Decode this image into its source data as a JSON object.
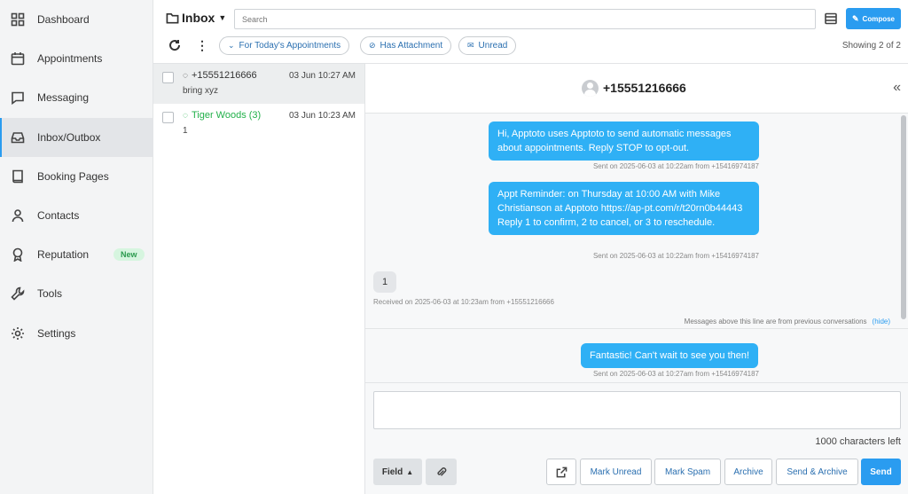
{
  "sidebar": {
    "items": [
      {
        "label": "Dashboard",
        "icon": "grid-icon"
      },
      {
        "label": "Appointments",
        "icon": "calendar-icon"
      },
      {
        "label": "Messaging",
        "icon": "chat-icon"
      },
      {
        "label": "Inbox/Outbox",
        "icon": "inbox-icon"
      },
      {
        "label": "Booking Pages",
        "icon": "book-icon"
      },
      {
        "label": "Contacts",
        "icon": "person-icon"
      },
      {
        "label": "Reputation",
        "icon": "award-icon",
        "badge": "New"
      },
      {
        "label": "Tools",
        "icon": "wrench-icon"
      },
      {
        "label": "Settings",
        "icon": "gear-icon"
      }
    ],
    "active": "Inbox/Outbox"
  },
  "header": {
    "folder": "Inbox",
    "search_placeholder": "Search",
    "compose_label": "Compose",
    "filters": [
      "For Today's Appointments",
      "Has Attachment",
      "Unread"
    ],
    "showing": "Showing 2 of 2"
  },
  "conversations": [
    {
      "name": "+15551216666",
      "date": "03 Jun 10:27 AM",
      "snippet": "bring xyz"
    },
    {
      "name": "Tiger Woods (3)",
      "date": "03 Jun 10:23 AM",
      "snippet": "1"
    }
  ],
  "thread": {
    "title": "+15551216666",
    "messages": [
      {
        "text": "Hi, Apptoto uses Apptoto to send automatic messages about appointments. Reply STOP to opt-out.",
        "meta": "Sent on 2025-06-03 at 10:22am from +15416974187"
      },
      {
        "text": "Appt Reminder: on Thursday at 10:00 AM with Mike Christianson at Apptoto https://ap-pt.com/r/t20rn0b44443 Reply 1 to confirm, 2 to cancel, or 3 to reschedule.",
        "meta": "Sent on 2025-06-03 at 10:22am from +15416974187"
      },
      {
        "text": "1",
        "meta": "Received on 2025-06-03 at 10:23am from +15551216666"
      },
      {
        "text": "Fantastic! Can't wait to see you then!",
        "meta": "Sent on 2025-06-03 at 10:27am from +15416974187"
      }
    ],
    "divider_text": "Messages above this line are from previous conversations",
    "hide_label": "(hide)"
  },
  "composer": {
    "chars_left": "1000 characters left",
    "field_label": "Field",
    "buttons": {
      "mark_unread": "Mark Unread",
      "mark_spam": "Mark Spam",
      "archive": "Archive",
      "send_archive": "Send & Archive",
      "send": "Send"
    }
  },
  "colors": {
    "accent": "#2a9cf0",
    "bubble_out": "#2fb0f5",
    "active_contact": "#22b04a"
  }
}
